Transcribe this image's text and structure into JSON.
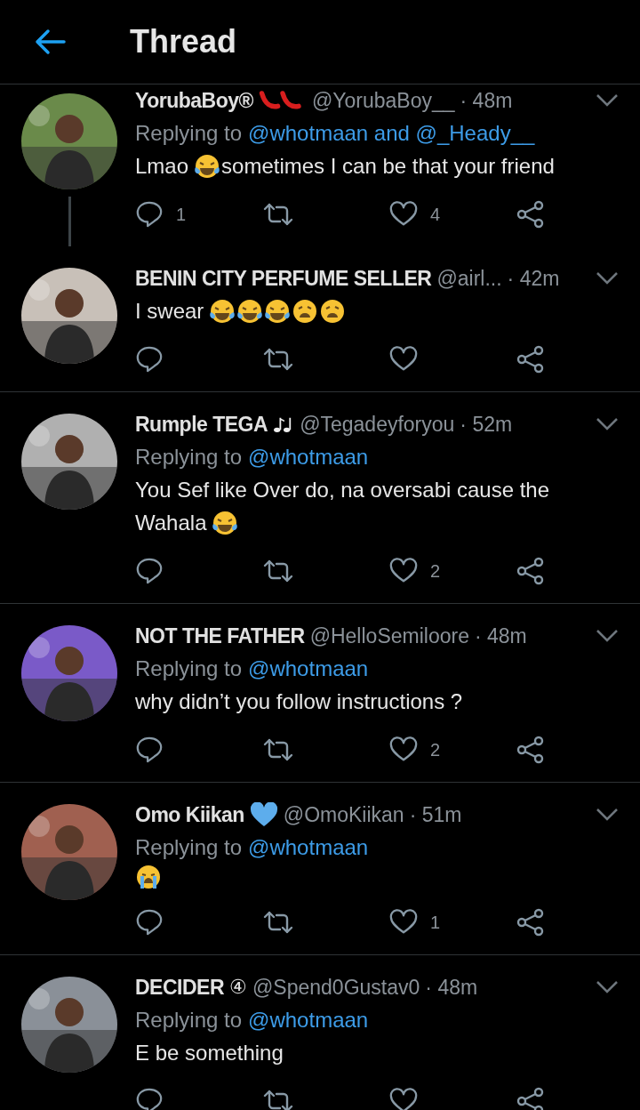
{
  "header": {
    "title": "Thread"
  },
  "tweets": [
    {
      "name": "YorubaBoy®",
      "badge": [
        {
          "kind": "chili"
        }
      ],
      "handle": "@YorubaBoy__",
      "time": "· 48m",
      "replying_label": "Replying to",
      "replying_to": "@whotmaan and @_Heady__",
      "body": [
        {
          "kind": "text",
          "text": "Lmao"
        },
        {
          "kind": "joy"
        },
        {
          "kind": "text",
          "text": "sometimes I can be that your friend"
        }
      ],
      "replies": "1",
      "likes": "4",
      "thread_line": true
    },
    {
      "name": "BENIN CITY PERFUME SELLER",
      "handle": "@airl...",
      "time": "· 42m",
      "body": [
        {
          "kind": "text",
          "text": "I swear"
        },
        {
          "kind": "joy"
        },
        {
          "kind": "joy"
        },
        {
          "kind": "joy"
        },
        {
          "kind": "weary"
        },
        {
          "kind": "weary"
        }
      ],
      "thread_line": false
    },
    {
      "name": "Rumple TEGA",
      "badge": [
        {
          "kind": "notes"
        }
      ],
      "handle": "@Tegadeyforyou",
      "time": "· 52m",
      "replying_label": "Replying to",
      "replying_to": "@whotmaan",
      "body": [
        {
          "kind": "text",
          "text": "You Sef like Over do, na oversabi cause the"
        },
        {
          "kind": "text",
          "text": "Wahala"
        },
        {
          "kind": "joy"
        }
      ],
      "likes": "2",
      "thread_line": false
    },
    {
      "name": "NOT THE FATHER",
      "handle": "@HelloSemiloore",
      "time": "· 48m",
      "replying_label": "Replying to",
      "replying_to": "@whotmaan",
      "body": [
        {
          "kind": "text",
          "text": "why didn’t you follow instructions ?"
        }
      ],
      "likes": "2",
      "thread_line": false
    },
    {
      "name": "Omo Kiikan",
      "badge": [
        {
          "kind": "heart"
        }
      ],
      "handle": "@OmoKiikan",
      "time": "· 51m",
      "replying_label": "Replying to",
      "replying_to": "@whotmaan",
      "body": [
        {
          "kind": "crying"
        }
      ],
      "likes": "1",
      "thread_line": false
    },
    {
      "name": "DECIDER",
      "badge_text": "④",
      "handle": "@Spend0Gustav0",
      "time": "· 48m",
      "replying_label": "Replying to",
      "replying_to": "@whotmaan",
      "body": [
        {
          "kind": "text",
          "text": "E be something"
        }
      ],
      "thread_line": false
    }
  ]
}
